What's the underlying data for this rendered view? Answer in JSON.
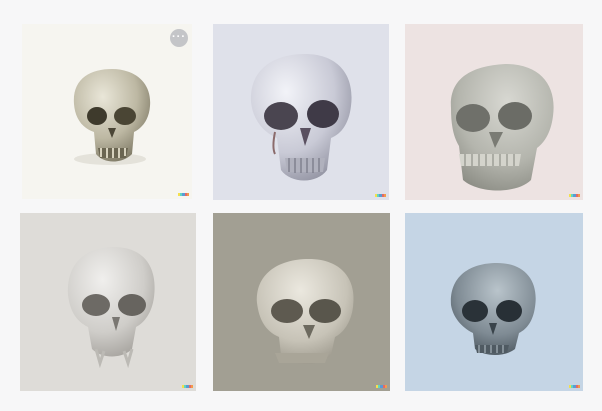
{
  "gallery": {
    "more_label": "···",
    "tiles": [
      {
        "label": "",
        "bg": "#f6f5f0"
      },
      {
        "label": "",
        "bg": "#dfe1ea"
      },
      {
        "label": "",
        "bg": "#ede3e2"
      },
      {
        "label": "",
        "bg": "#dedcd8"
      },
      {
        "label": "",
        "bg": "#a29f93"
      },
      {
        "label": "",
        "bg": "#c5d5e5"
      }
    ],
    "signature_colors": [
      "#f4e04d",
      "#61d6c2",
      "#5a9bd5",
      "#e26a6a",
      "#f29b4b"
    ]
  }
}
